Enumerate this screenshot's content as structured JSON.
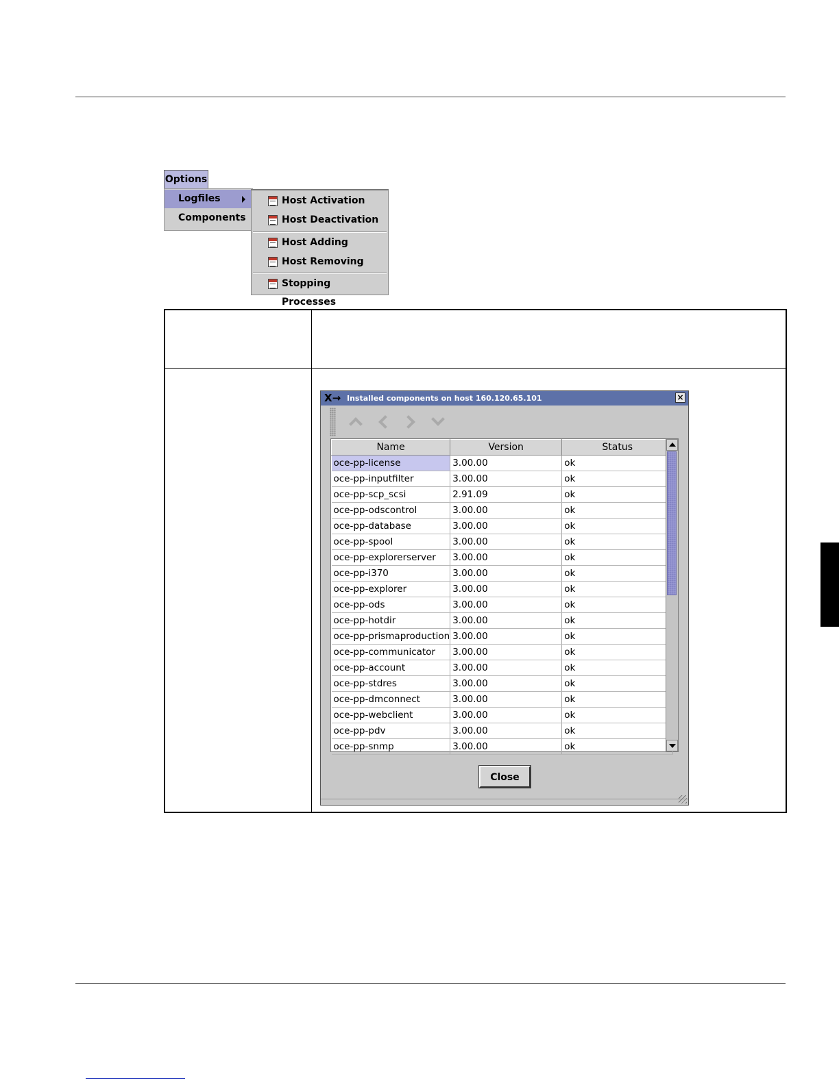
{
  "options_menu": {
    "title": "Options",
    "items": [
      {
        "label": "Logfiles"
      },
      {
        "label": "Components"
      }
    ],
    "logfiles_submenu": [
      {
        "label": "Host Activation",
        "icon": "log-icon"
      },
      {
        "label": "Host Deactivation",
        "icon": "log-icon"
      },
      {
        "label": "Host Adding",
        "icon": "log-icon"
      },
      {
        "label": "Host Removing",
        "icon": "log-icon"
      },
      {
        "label": "Stopping Processes",
        "icon": "log-icon"
      }
    ],
    "highlight_color": "#9c9ccf"
  },
  "dialog": {
    "logo": "X→",
    "title": "Installed components on host 160.120.65.101",
    "titlebar_color": "#5d71a8",
    "toolbar_icons": [
      "chevron-up-icon",
      "chevron-left-icon",
      "chevron-right-icon",
      "chevron-down-icon"
    ],
    "columns": [
      "Name",
      "Version",
      "Status"
    ],
    "selected_row": 0,
    "rows": [
      {
        "name": "oce-pp-license",
        "version": "3.00.00",
        "status": "ok"
      },
      {
        "name": "oce-pp-inputfilter",
        "version": "3.00.00",
        "status": "ok"
      },
      {
        "name": "oce-pp-scp_scsi",
        "version": "2.91.09",
        "status": "ok"
      },
      {
        "name": "oce-pp-odscontrol",
        "version": "3.00.00",
        "status": "ok"
      },
      {
        "name": "oce-pp-database",
        "version": "3.00.00",
        "status": "ok"
      },
      {
        "name": "oce-pp-spool",
        "version": "3.00.00",
        "status": "ok"
      },
      {
        "name": "oce-pp-explorerserver",
        "version": "3.00.00",
        "status": "ok"
      },
      {
        "name": "oce-pp-i370",
        "version": "3.00.00",
        "status": "ok"
      },
      {
        "name": "oce-pp-explorer",
        "version": "3.00.00",
        "status": "ok"
      },
      {
        "name": "oce-pp-ods",
        "version": "3.00.00",
        "status": "ok"
      },
      {
        "name": "oce-pp-hotdir",
        "version": "3.00.00",
        "status": "ok"
      },
      {
        "name": "oce-pp-prismaproduction",
        "version": "3.00.00",
        "status": "ok"
      },
      {
        "name": "oce-pp-communicator",
        "version": "3.00.00",
        "status": "ok"
      },
      {
        "name": "oce-pp-account",
        "version": "3.00.00",
        "status": "ok"
      },
      {
        "name": "oce-pp-stdres",
        "version": "3.00.00",
        "status": "ok"
      },
      {
        "name": "oce-pp-dmconnect",
        "version": "3.00.00",
        "status": "ok"
      },
      {
        "name": "oce-pp-webclient",
        "version": "3.00.00",
        "status": "ok"
      },
      {
        "name": "oce-pp-pdv",
        "version": "3.00.00",
        "status": "ok"
      },
      {
        "name": "oce-pp-snmp",
        "version": "3.00.00",
        "status": "ok"
      }
    ],
    "close_label": "Close"
  }
}
